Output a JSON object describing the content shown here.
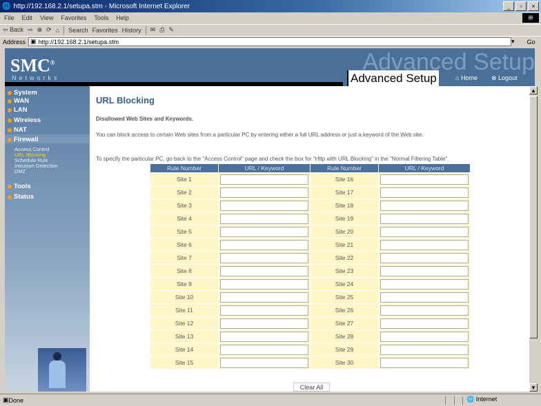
{
  "window": {
    "title": "http://192.168.2.1/setupa.stm - Microsoft Internet Explorer",
    "buttons": [
      "_",
      "▫",
      "×"
    ]
  },
  "menu": [
    "File",
    "Edit",
    "View",
    "Favorites",
    "Tools",
    "Help"
  ],
  "toolbar": {
    "back": "⇦ Back",
    "forward": "⇨",
    "search": "Search",
    "favorites": "Favorites",
    "history": "History"
  },
  "address": {
    "label": "Address",
    "url": "http://192.168.2.1/setupa.stm",
    "go": "Go"
  },
  "header": {
    "logo": "SMC",
    "logo_mark": "®",
    "logo_sub": "Networks",
    "watermark": "Advanced Setup",
    "title": "Advanced Setup",
    "home": "Home",
    "logout": "Logout"
  },
  "sidebar": {
    "items": [
      "System",
      "WAN",
      "LAN",
      "Wireless",
      "NAT",
      "Firewall",
      "Tools",
      "Status"
    ],
    "firewall_sub": [
      "Access Control",
      "URL Blocking",
      "Schedule Rule",
      "Intrusion Detection",
      "DMZ"
    ]
  },
  "page": {
    "title": "URL Blocking",
    "subheading": "Disallowed Web Sites and Keywords.",
    "para1": "You can block access to certain Web sites from a particular PC by entering either a full URL address or just a keyword of the Web site.",
    "para2": "To specify the particular PC, go back to the \"Access Control\" page and check the box for \"Http with URL Blocking\" in the \"Normal Filtering Table\"."
  },
  "table": {
    "headers": [
      "Rule Number",
      "URL / Keyword",
      "Rule Number",
      "URL / Keyword"
    ],
    "left": [
      "Site  1",
      "Site  2",
      "Site  3",
      "Site  4",
      "Site  5",
      "Site  6",
      "Site  7",
      "Site  8",
      "Site  9",
      "Site  10",
      "Site  11",
      "Site  12",
      "Site  13",
      "Site  14",
      "Site  15"
    ],
    "right": [
      "Site  16",
      "Site  17",
      "Site  18",
      "Site  19",
      "Site  20",
      "Site  21",
      "Site  22",
      "Site  23",
      "Site  24",
      "Site  25",
      "Site  26",
      "Site  27",
      "Site  28",
      "Site  29",
      "Site  30"
    ]
  },
  "clear_all": "Clear All",
  "status": {
    "text": "Done",
    "zone": "Internet"
  }
}
